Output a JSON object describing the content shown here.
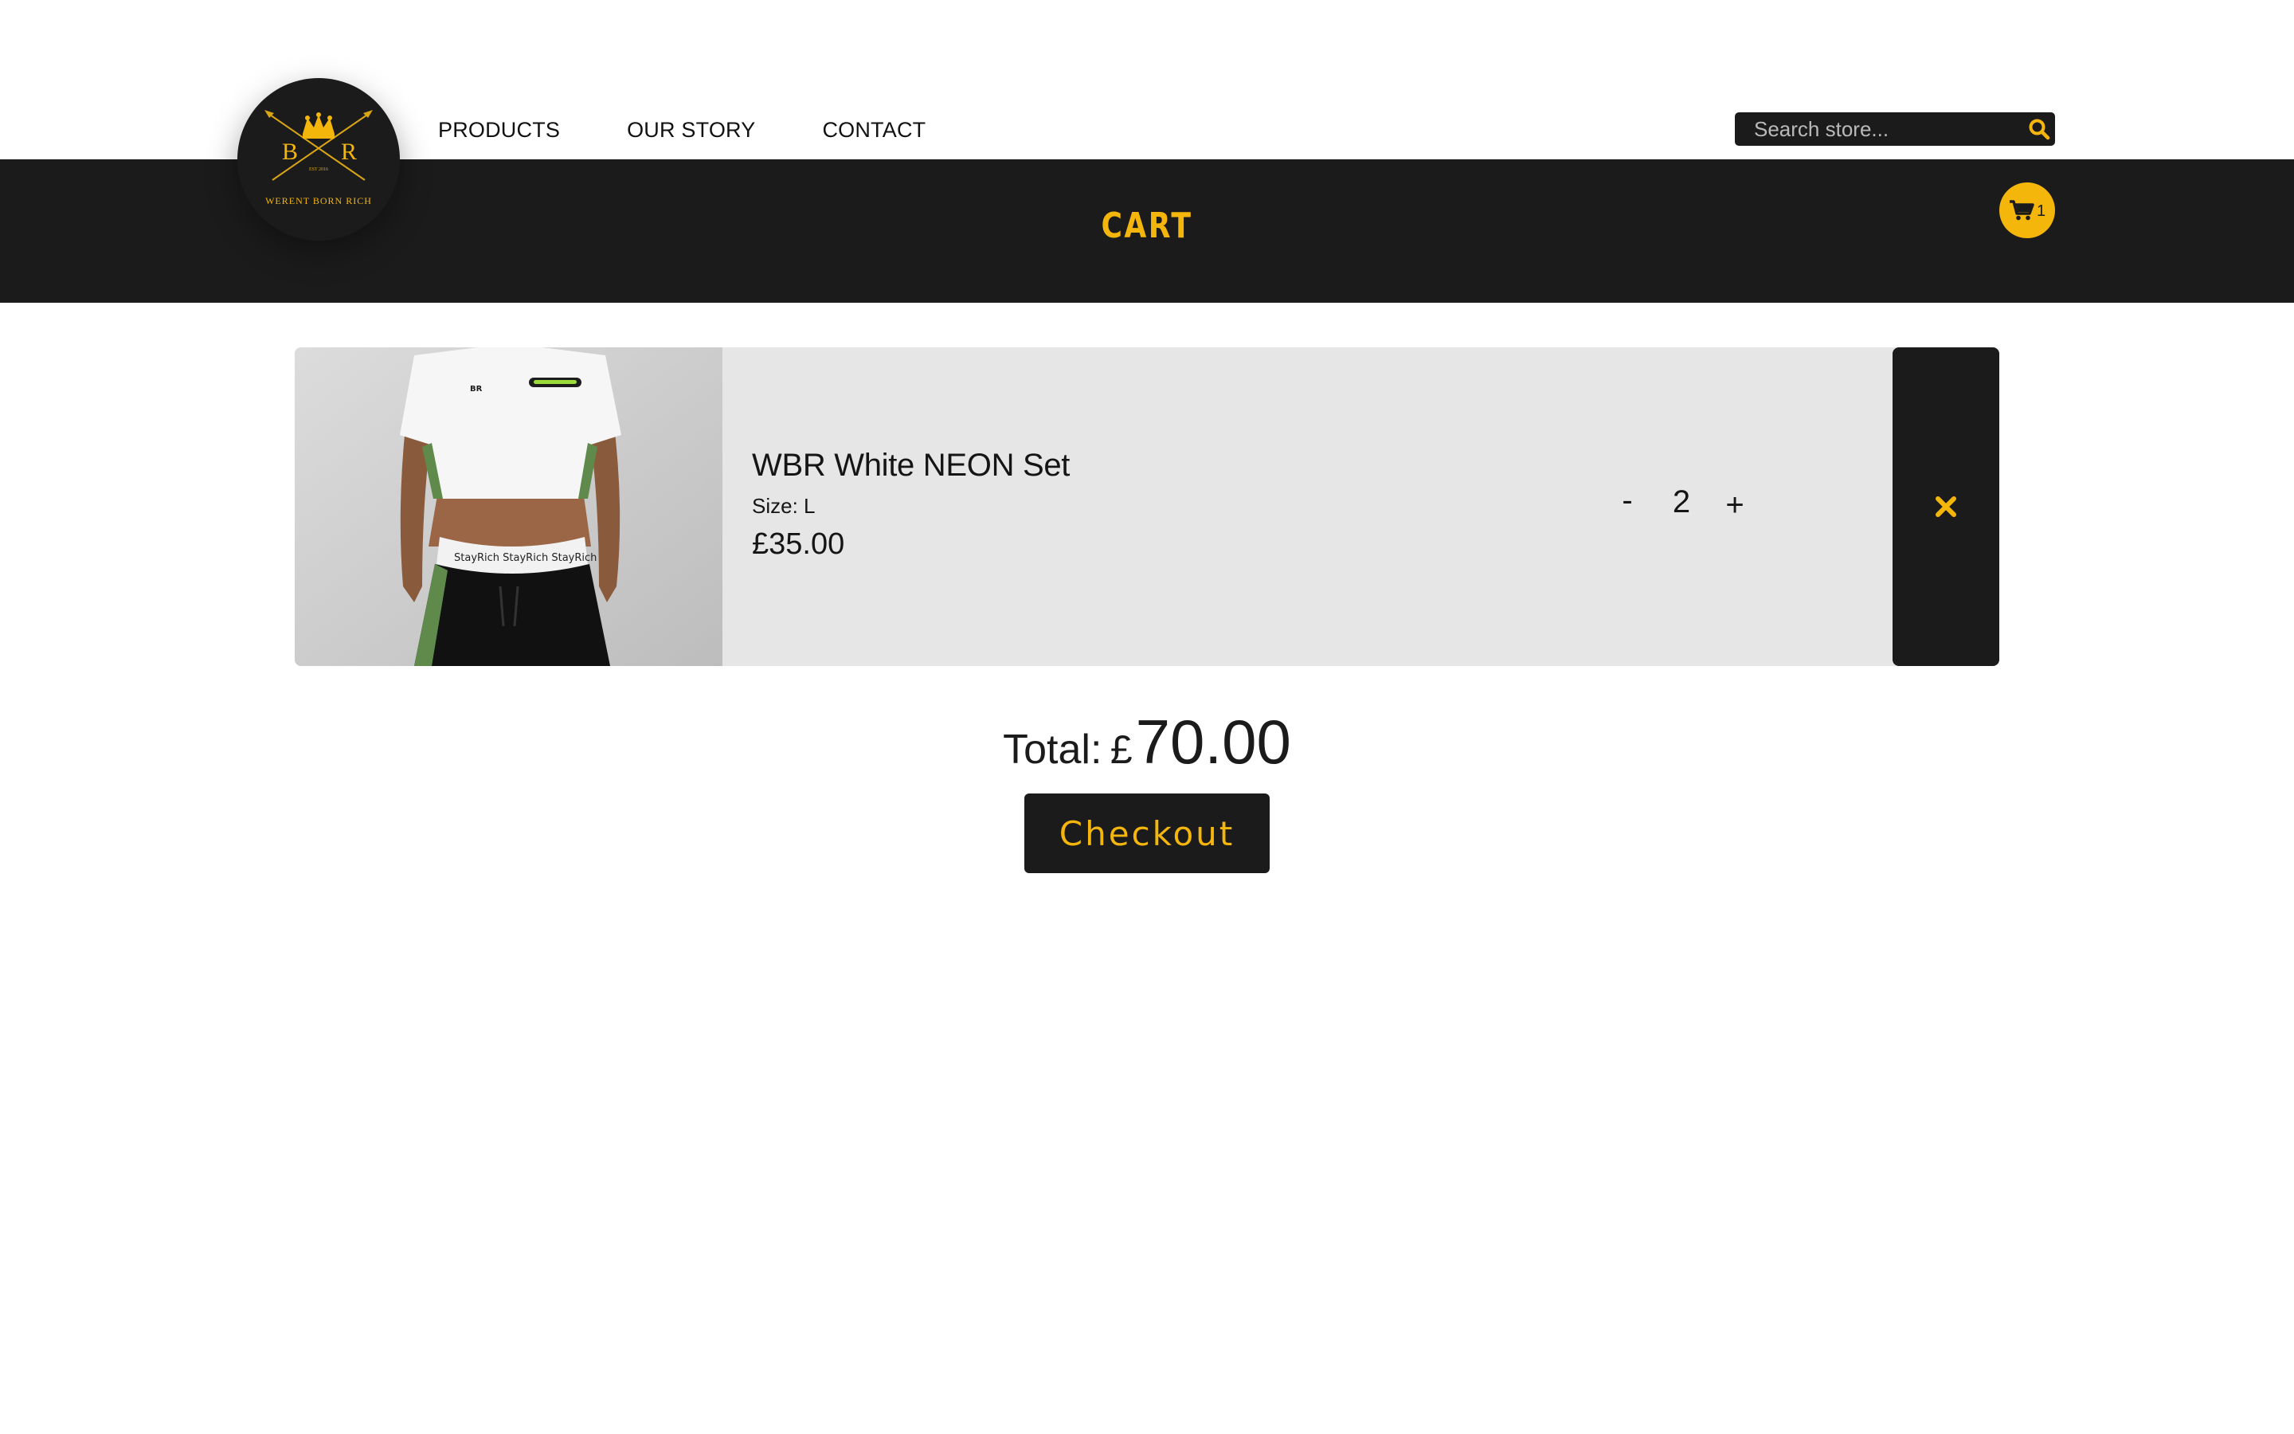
{
  "header": {
    "logo": {
      "initials_left": "B",
      "initials_right": "R",
      "est": "EST 2016",
      "brand": "WERENT BORN RICH"
    },
    "nav": [
      {
        "label": "PRODUCTS"
      },
      {
        "label": "OUR STORY"
      },
      {
        "label": "CONTACT"
      }
    ],
    "search": {
      "placeholder": "Search store...",
      "value": ""
    },
    "cart_count": "1"
  },
  "banner": {
    "title": "CART"
  },
  "cart": {
    "items": [
      {
        "name": "WBR White NEON Set",
        "size_label": "Size: L",
        "price": "£35.00",
        "quantity": "2",
        "minus_label": "-",
        "plus_label": "+",
        "remove_icon": "close-icon"
      }
    ],
    "total_label": "Total:",
    "total_currency": "£",
    "total_amount": "70.00",
    "checkout_label": "Checkout"
  },
  "colors": {
    "accent": "#f5b60c",
    "dark": "#1b1b1b",
    "card_bg": "#e6e6e6"
  }
}
